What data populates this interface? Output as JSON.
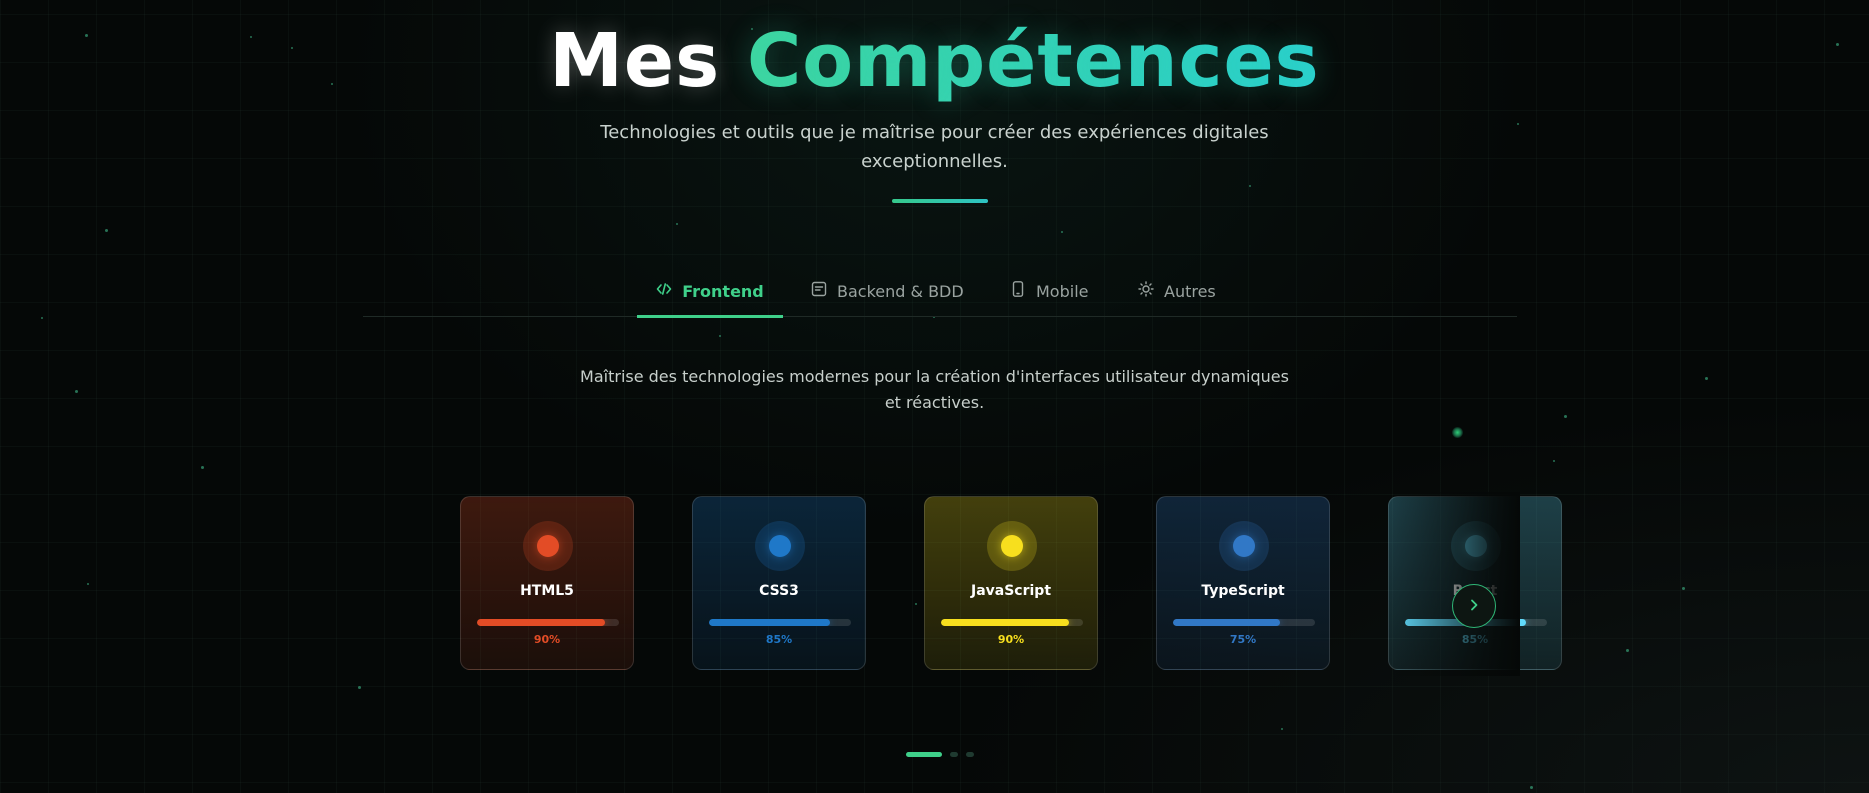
{
  "header": {
    "title_part1": "Mes",
    "title_part2": "Compétences",
    "subtitle_line1": "Technologies et outils que je maîtrise pour créer des expériences digitales",
    "subtitle_line2": "exceptionnelles."
  },
  "tabs": [
    {
      "label": "Frontend",
      "icon": "code-icon",
      "active": true
    },
    {
      "label": "Backend & BDD",
      "icon": "database-icon",
      "active": false
    },
    {
      "label": "Mobile",
      "icon": "smartphone-icon",
      "active": false
    },
    {
      "label": "Autres",
      "icon": "sun-icon",
      "active": false
    }
  ],
  "description": {
    "line1": "Maîtrise des technologies modernes pour la création d'interfaces utilisateur dynamiques",
    "line2": "et réactives."
  },
  "skills": [
    {
      "name": "HTML5",
      "percent_label": "90%",
      "level": 0.9,
      "color": "#e34c26"
    },
    {
      "name": "CSS3",
      "percent_label": "85%",
      "level": 0.85,
      "color": "#1f78c8"
    },
    {
      "name": "JavaScript",
      "percent_label": "90%",
      "level": 0.9,
      "color": "#f7df1e"
    },
    {
      "name": "TypeScript",
      "percent_label": "75%",
      "level": 0.75,
      "color": "#3178c6"
    },
    {
      "name": "React",
      "percent_label": "85%",
      "level": 0.85,
      "color": "#61dafb"
    }
  ],
  "carousel": {
    "next_icon": "chevron-right-icon",
    "page_count": 3,
    "active_page": 0
  },
  "colors": {
    "accent": "#3fd08a",
    "background": "#050807"
  }
}
